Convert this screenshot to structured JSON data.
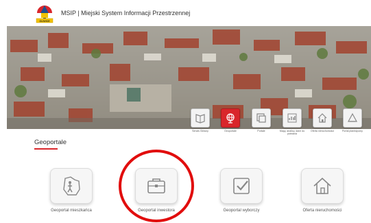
{
  "header": {
    "title": "MSIP | Miejski System Informacji Przestrzennej",
    "logo_icon": "city-crest-icon",
    "logo_text": "GLIWICE"
  },
  "nav_tiles": [
    {
      "label": "Serwis Główny",
      "icon": "book-icon",
      "active": false
    },
    {
      "label": "Geoportale",
      "icon": "globe-icon",
      "active": true
    },
    {
      "label": "Portale",
      "icon": "windows-icon",
      "active": false
    },
    {
      "label": "Mapy, analizy, dane do pobrania",
      "icon": "chart-icon",
      "active": false
    },
    {
      "label": "Oferta nieruchomości",
      "icon": "house-icon",
      "active": false
    },
    {
      "label": "Portal planistyczny",
      "icon": "triangle-icon",
      "active": false
    }
  ],
  "section": {
    "title": "Geoportale"
  },
  "geoportals": [
    {
      "label": "Geoportal mieszkańca",
      "icon": "resident-map-icon"
    },
    {
      "label": "Geoportal inwestora",
      "icon": "briefcase-icon"
    },
    {
      "label": "Geoportal wyborczy",
      "icon": "checkbox-icon"
    },
    {
      "label": "Oferta nieruchomości",
      "icon": "house-icon"
    }
  ],
  "colors": {
    "accent": "#d9262b",
    "highlight_circle": "#e10d0d"
  }
}
